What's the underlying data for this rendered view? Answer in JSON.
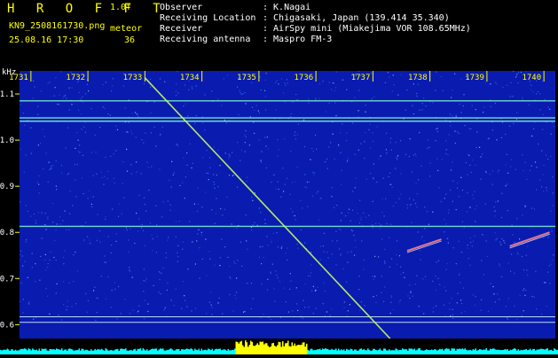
{
  "header": {
    "brand": "H R O F F T",
    "version": "1.0f",
    "filename": "KN9_2508161730.png",
    "meteor_label": "meteor",
    "datetime": "25.08.16 17:30",
    "count": "36",
    "meta": [
      {
        "key": "Observer",
        "value": ": K.Nagai"
      },
      {
        "key": "Receiving Location",
        "value": ": Chigasaki, Japan (139.414 35.340)"
      },
      {
        "key": "Receiver",
        "value": ": AirSpy mini (Miakejima VOR 108.65MHz)"
      },
      {
        "key": "Receiving antenna",
        "value": ": Maspro FM-3"
      }
    ]
  },
  "chart_data": {
    "type": "heatmap",
    "title": "",
    "xlabel": "",
    "ylabel": "kHz",
    "x_ticks": [
      "1731",
      "1732",
      "1733",
      "1734",
      "1735",
      "1736",
      "1737",
      "1738",
      "1739",
      "1740"
    ],
    "y_ticks": [
      "1.1",
      "1.0",
      "0.9",
      "0.8",
      "0.7",
      "0.6"
    ],
    "ylim": [
      0.57,
      1.15
    ],
    "xlim": [
      1730.8,
      1740.2
    ],
    "horizontal_lines_khz": [
      1.085,
      1.048,
      1.041,
      0.813,
      0.617,
      0.605
    ],
    "diagonal_signal": {
      "start": {
        "x": 1733.0,
        "y": 1.135
      },
      "end": {
        "x": 1737.3,
        "y": 0.57
      }
    },
    "meteor_echoes": [
      {
        "x_start": 1737.6,
        "x_end": 1738.2,
        "y_start": 0.76,
        "y_end": 0.785
      },
      {
        "x_start": 1739.4,
        "x_end": 1740.1,
        "y_start": 0.77,
        "y_end": 0.8
      }
    ],
    "colors": {
      "background": "#0a1bb0",
      "noise": "#3a7cff",
      "signal": "#7fffd0",
      "tick": "#ffff00",
      "label": "#ffffff",
      "bottom": "#00ffff",
      "bottom_hi": "#ffff00"
    }
  }
}
